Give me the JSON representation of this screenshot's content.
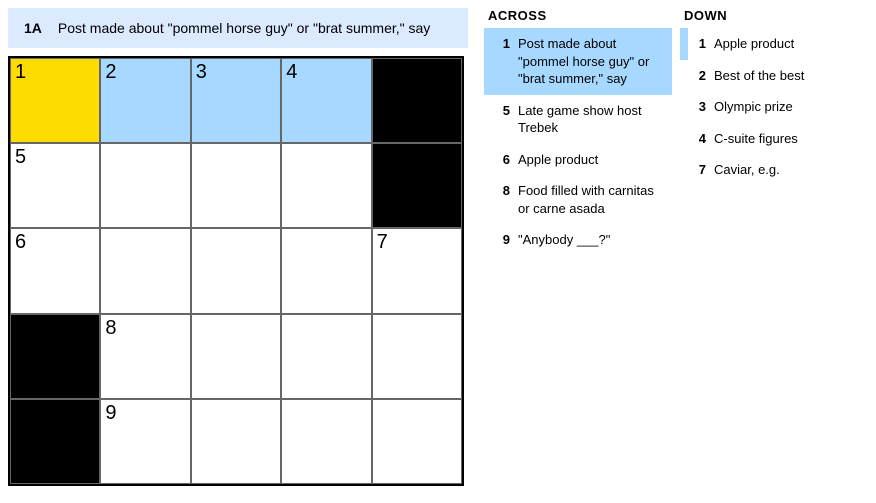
{
  "activeClue": {
    "label": "1A",
    "text": "Post made about \"pommel horse guy\" or \"brat summer,\" say"
  },
  "grid": {
    "rows": 5,
    "cols": 5,
    "cells": [
      [
        {
          "n": "1",
          "state": "focus"
        },
        {
          "n": "2",
          "state": "highlight"
        },
        {
          "n": "3",
          "state": "highlight"
        },
        {
          "n": "4",
          "state": "highlight"
        },
        {
          "state": "block"
        }
      ],
      [
        {
          "n": "5"
        },
        {},
        {},
        {},
        {
          "state": "block"
        }
      ],
      [
        {
          "n": "6"
        },
        {},
        {},
        {},
        {
          "n": "7"
        }
      ],
      [
        {
          "state": "block"
        },
        {
          "n": "8"
        },
        {},
        {},
        {}
      ],
      [
        {
          "state": "block"
        },
        {
          "n": "9"
        },
        {},
        {},
        {}
      ]
    ]
  },
  "clues": {
    "acrossTitle": "ACROSS",
    "downTitle": "DOWN",
    "across": [
      {
        "num": "1",
        "text": "Post made about \"pommel horse guy\" or \"brat summer,\" say",
        "active": true
      },
      {
        "num": "5",
        "text": "Late game show host Trebek"
      },
      {
        "num": "6",
        "text": "Apple product"
      },
      {
        "num": "8",
        "text": "Food filled with carnitas or carne asada"
      },
      {
        "num": "9",
        "text": "\"Anybody ___?\""
      }
    ],
    "down": [
      {
        "num": "1",
        "text": "Apple product",
        "related": true
      },
      {
        "num": "2",
        "text": "Best of the best"
      },
      {
        "num": "3",
        "text": "Olympic prize"
      },
      {
        "num": "4",
        "text": "C-suite figures"
      },
      {
        "num": "7",
        "text": "Caviar, e.g."
      }
    ]
  }
}
